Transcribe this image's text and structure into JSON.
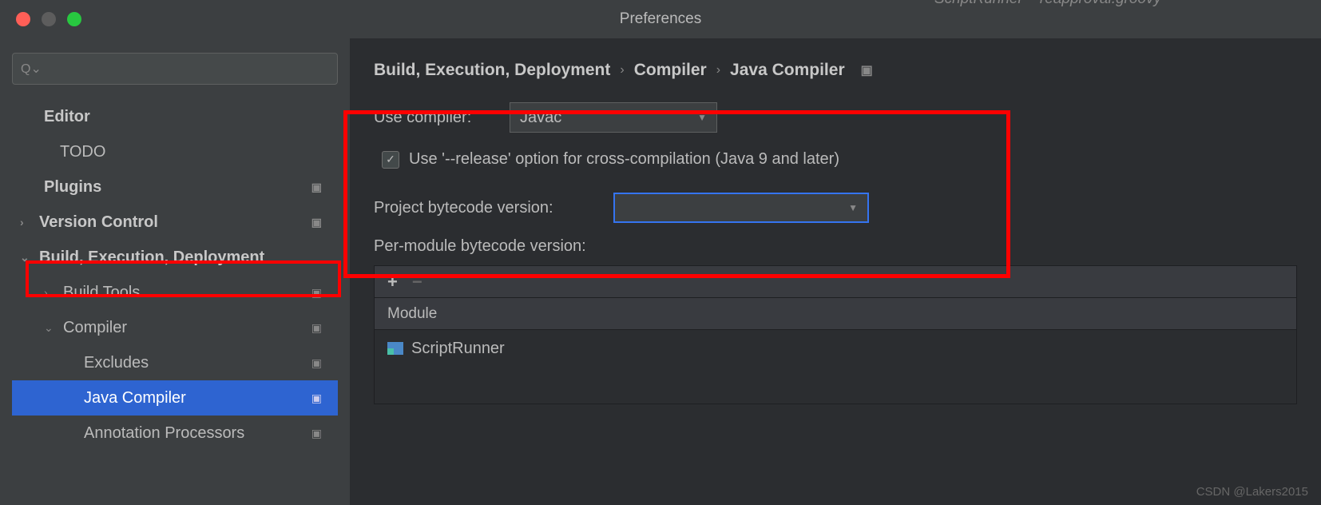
{
  "window": {
    "title": "Preferences",
    "tab_title": "ScriptRunner – reapproval.groovy"
  },
  "sidebar": {
    "search_placeholder": "",
    "items": {
      "editor": "Editor",
      "todo": "TODO",
      "plugins": "Plugins",
      "version_control": "Version Control",
      "build_exec_deploy": "Build, Execution, Deployment",
      "build_tools": "Build Tools",
      "compiler": "Compiler",
      "excludes": "Excludes",
      "java_compiler": "Java Compiler",
      "annotation_processors": "Annotation Processors"
    }
  },
  "breadcrumb": {
    "l1": "Build, Execution, Deployment",
    "l2": "Compiler",
    "l3": "Java Compiler"
  },
  "form": {
    "use_compiler_label": "Use compiler:",
    "use_compiler_value": "Javac",
    "release_option_label": "Use '--release' option for cross-compilation (Java 9 and later)",
    "project_bytecode_label": "Project bytecode version:",
    "project_bytecode_value": "",
    "per_module_label": "Per-module bytecode version:"
  },
  "table": {
    "header_module": "Module",
    "rows": [
      {
        "name": "ScriptRunner"
      }
    ]
  },
  "credit": "CSDN @Lakers2015"
}
